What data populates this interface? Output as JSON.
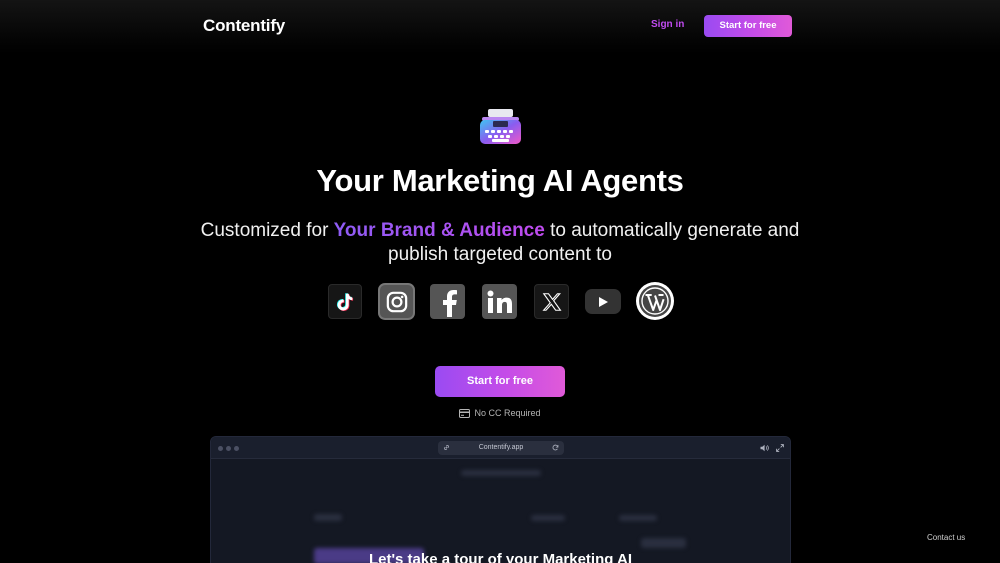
{
  "nav": {
    "logo": "Contentify",
    "signin_label": "Sign in",
    "start_label": "Start for free"
  },
  "hero": {
    "icon": "typewriter-icon",
    "title": "Your Marketing AI Agents",
    "subtitle_before": "Customized for ",
    "subtitle_highlight": "Your Brand & Audience",
    "subtitle_after": " to automatically generate and publish targeted content to",
    "platforms": [
      {
        "name": "tiktok-icon"
      },
      {
        "name": "instagram-icon"
      },
      {
        "name": "facebook-icon"
      },
      {
        "name": "linkedin-icon"
      },
      {
        "name": "x-icon"
      },
      {
        "name": "youtube-icon"
      },
      {
        "name": "wordpress-icon"
      }
    ],
    "cta_label": "Start for free",
    "note": "No CC Required"
  },
  "preview": {
    "url": "Contentify.app",
    "tour_text": "Let's take a tour of your Marketing AI"
  },
  "footer": {
    "contact_label": "Contact us"
  },
  "colors": {
    "accent_purple": "#9a4bf2",
    "accent_pink": "#e05ad8",
    "background": "#000000"
  }
}
